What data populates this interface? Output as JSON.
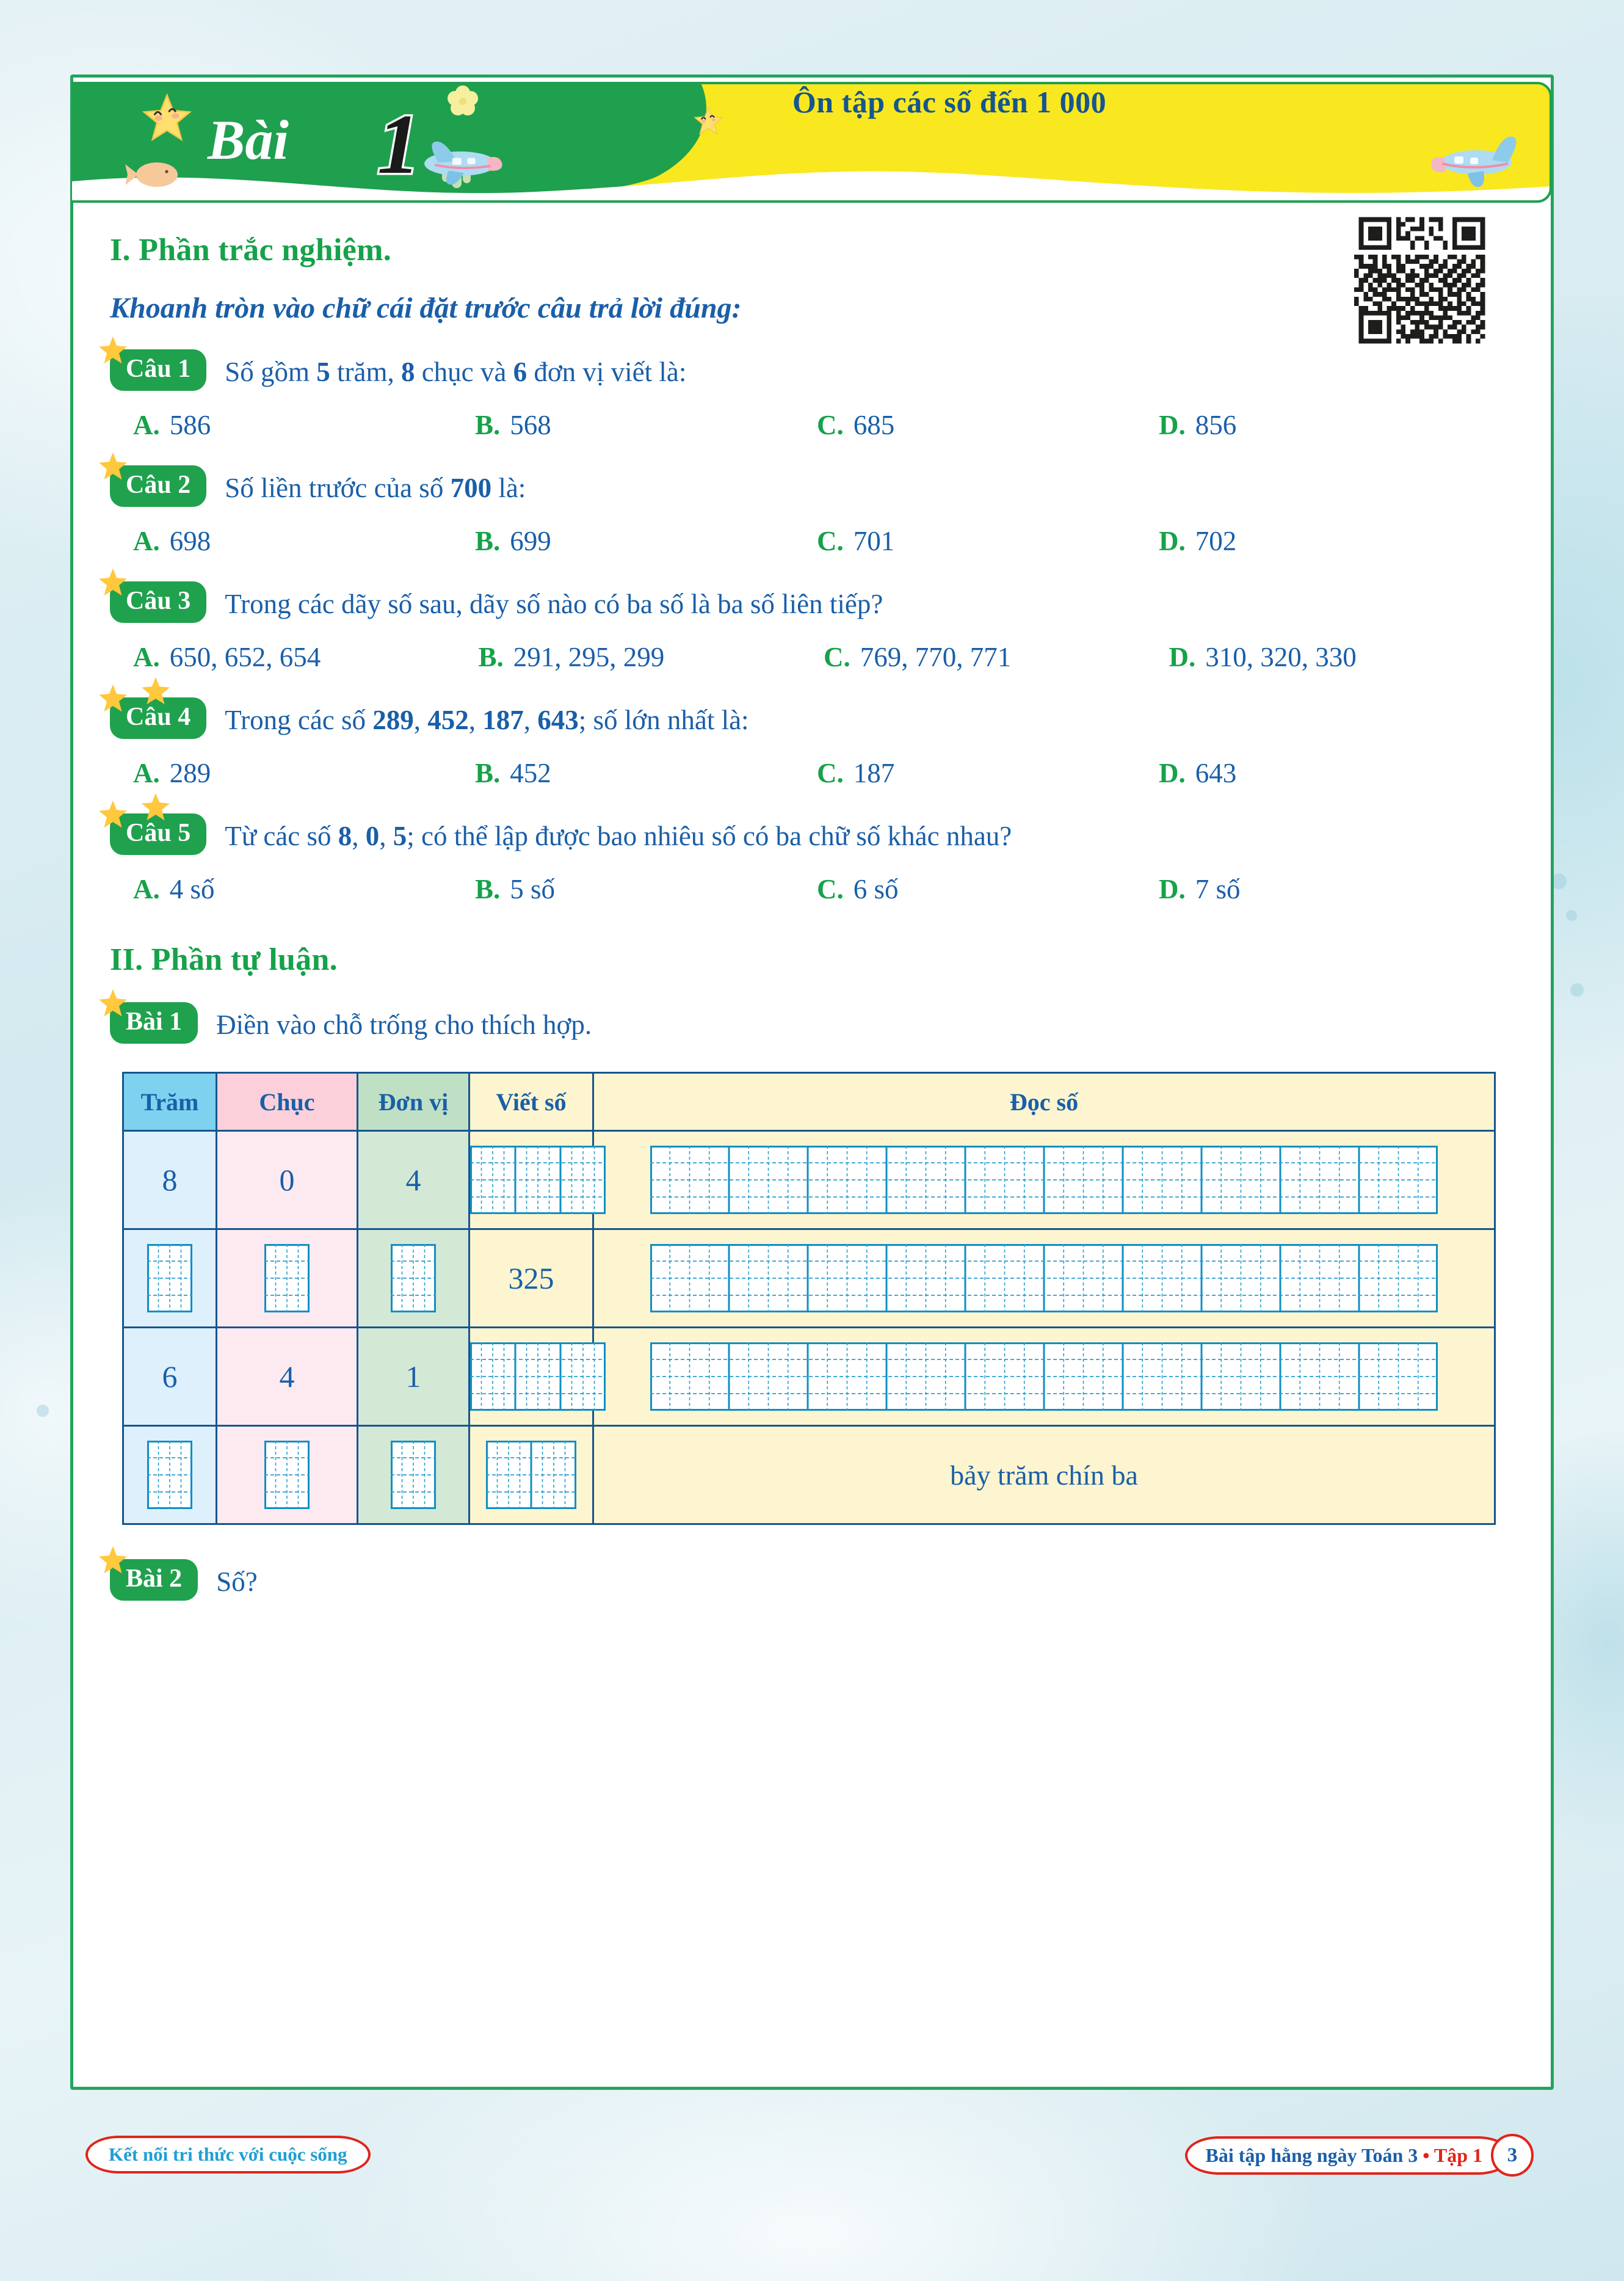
{
  "header": {
    "lesson_word": "Bài",
    "lesson_number": "1",
    "title": "Ôn tập các số đến 1 000"
  },
  "sections": {
    "part1_heading": "I. Phần trắc nghiệm.",
    "part1_instruction": "Khoanh tròn vào chữ cái đặt trước câu trả lời đúng:",
    "part2_heading": "II. Phần tự luận."
  },
  "questions": [
    {
      "badge": "Câu 1",
      "stars": 1,
      "text_parts": [
        {
          "t": "Số gồm ",
          "b": false
        },
        {
          "t": "5",
          "b": true
        },
        {
          "t": " trăm, ",
          "b": false
        },
        {
          "t": "8",
          "b": true
        },
        {
          "t": " chục và ",
          "b": false
        },
        {
          "t": "6",
          "b": true
        },
        {
          "t": " đơn vị viết là:",
          "b": false
        }
      ],
      "options": [
        {
          "letter": "A.",
          "value": "586"
        },
        {
          "letter": "B.",
          "value": "568"
        },
        {
          "letter": "C.",
          "value": "685"
        },
        {
          "letter": "D.",
          "value": "856"
        }
      ],
      "wide": false
    },
    {
      "badge": "Câu 2",
      "stars": 1,
      "text_parts": [
        {
          "t": "Số liền trước của số ",
          "b": false
        },
        {
          "t": "700",
          "b": true
        },
        {
          "t": " là:",
          "b": false
        }
      ],
      "options": [
        {
          "letter": "A.",
          "value": "698"
        },
        {
          "letter": "B.",
          "value": "699"
        },
        {
          "letter": "C.",
          "value": "701"
        },
        {
          "letter": "D.",
          "value": "702"
        }
      ],
      "wide": false
    },
    {
      "badge": "Câu 3",
      "stars": 1,
      "text_parts": [
        {
          "t": "Trong các dãy số sau, dãy số nào có ba số là ba số liên tiếp?",
          "b": false
        }
      ],
      "options": [
        {
          "letter": "A.",
          "value": "650, 652, 654"
        },
        {
          "letter": "B.",
          "value": "291, 295, 299"
        },
        {
          "letter": "C.",
          "value": "769, 770, 771"
        },
        {
          "letter": "D.",
          "value": "310, 320, 330"
        }
      ],
      "wide": true
    },
    {
      "badge": "Câu 4",
      "stars": 2,
      "text_parts": [
        {
          "t": "Trong các số ",
          "b": false
        },
        {
          "t": "289",
          "b": true
        },
        {
          "t": ", ",
          "b": false
        },
        {
          "t": "452",
          "b": true
        },
        {
          "t": ", ",
          "b": false
        },
        {
          "t": "187",
          "b": true
        },
        {
          "t": ", ",
          "b": false
        },
        {
          "t": "643",
          "b": true
        },
        {
          "t": "; số lớn nhất là:",
          "b": false
        }
      ],
      "options": [
        {
          "letter": "A.",
          "value": "289"
        },
        {
          "letter": "B.",
          "value": "452"
        },
        {
          "letter": "C.",
          "value": "187"
        },
        {
          "letter": "D.",
          "value": "643"
        }
      ],
      "wide": false
    },
    {
      "badge": "Câu 5",
      "stars": 2,
      "text_parts": [
        {
          "t": "Từ các số ",
          "b": false
        },
        {
          "t": "8",
          "b": true
        },
        {
          "t": ", ",
          "b": false
        },
        {
          "t": "0",
          "b": true
        },
        {
          "t": ", ",
          "b": false
        },
        {
          "t": "5",
          "b": true
        },
        {
          "t": "; có thể lập được bao nhiêu số có ba chữ số khác nhau?",
          "b": false
        }
      ],
      "options": [
        {
          "letter": "A.",
          "value": "4 số"
        },
        {
          "letter": "B.",
          "value": "5 số"
        },
        {
          "letter": "C.",
          "value": "6 số"
        },
        {
          "letter": "D.",
          "value": "7 số"
        }
      ],
      "wide": false
    }
  ],
  "exercises": [
    {
      "badge": "Bài 1",
      "stars": 1,
      "text": "Điền vào chỗ trống cho thích hợp."
    },
    {
      "badge": "Bài 2",
      "stars": 1,
      "text": "Số?"
    }
  ],
  "table": {
    "headers": [
      "Trăm",
      "Chục",
      "Đơn vị",
      "Viết số",
      "Đọc số"
    ],
    "rows": [
      {
        "tram": {
          "type": "value",
          "value": "8"
        },
        "chuc": {
          "type": "value",
          "value": "0"
        },
        "donvi": {
          "type": "value",
          "value": "4"
        },
        "viet": {
          "type": "grid",
          "cells": 3
        },
        "doc": {
          "type": "grid",
          "cells": 10
        }
      },
      {
        "tram": {
          "type": "grid",
          "cells": 1
        },
        "chuc": {
          "type": "grid",
          "cells": 1
        },
        "donvi": {
          "type": "grid",
          "cells": 1
        },
        "viet": {
          "type": "value",
          "value": "325"
        },
        "doc": {
          "type": "grid",
          "cells": 10
        }
      },
      {
        "tram": {
          "type": "value",
          "value": "6"
        },
        "chuc": {
          "type": "value",
          "value": "4"
        },
        "donvi": {
          "type": "value",
          "value": "1"
        },
        "viet": {
          "type": "grid",
          "cells": 3
        },
        "doc": {
          "type": "grid",
          "cells": 10
        }
      },
      {
        "tram": {
          "type": "grid",
          "cells": 1
        },
        "chuc": {
          "type": "grid",
          "cells": 1
        },
        "donvi": {
          "type": "grid",
          "cells": 1
        },
        "viet": {
          "type": "grid",
          "cells": 2
        },
        "doc": {
          "type": "value",
          "value": "bảy trăm chín ba"
        }
      }
    ]
  },
  "footer": {
    "left_text": "Kết nối tri thức với cuộc sống",
    "right_text": "Bài tập hằng ngày Toán 3",
    "right_separator": "•",
    "right_volume": "Tập 1",
    "page_number": "3"
  },
  "colors": {
    "green": "#20a14e",
    "blue": "#1a5fa8",
    "yellow": "#f9e81f",
    "red": "#e2231a",
    "header_tram": "#7fd2ef",
    "header_chuc": "#fbd0da",
    "header_donvi": "#bfe0c4",
    "header_cream": "#fcf5d0"
  }
}
